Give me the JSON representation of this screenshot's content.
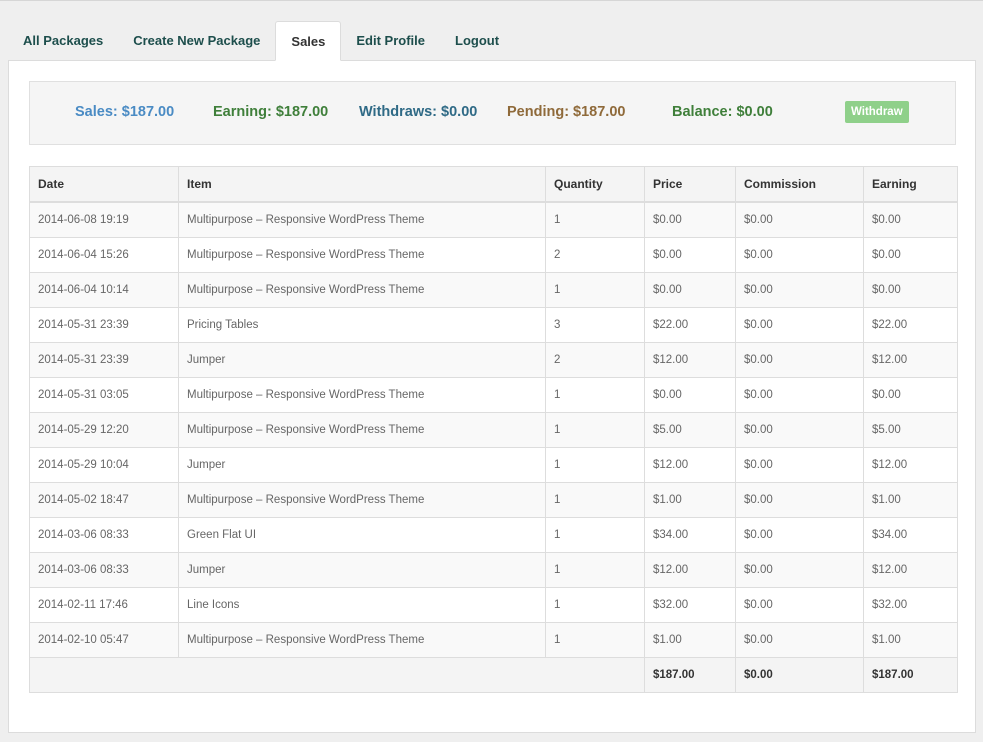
{
  "tabs": [
    {
      "label": "All Packages"
    },
    {
      "label": "Create New Package"
    },
    {
      "label": "Sales"
    },
    {
      "label": "Edit Profile"
    },
    {
      "label": "Logout"
    }
  ],
  "active_tab": "Sales",
  "summary": {
    "sales": "Sales: $187.00",
    "earning": "Earning: $187.00",
    "withdraws": "Withdraws: $0.00",
    "pending": "Pending: $187.00",
    "balance": "Balance: $0.00",
    "withdraw_button": "Withdraw"
  },
  "colors": {
    "sales": "#4a8bc4",
    "earning": "#3f7f3a",
    "withdraws": "#2f6a86",
    "pending": "#8f6a3a",
    "balance": "#3f7f3a",
    "withdraw_button": "#8fd08a"
  },
  "table": {
    "headers": [
      "Date",
      "Item",
      "Quantity",
      "Price",
      "Commission",
      "Earning"
    ],
    "rows": [
      [
        "2014-06-08 19:19",
        "Multipurpose – Responsive WordPress Theme",
        "1",
        "$0.00",
        "$0.00",
        "$0.00"
      ],
      [
        "2014-06-04 15:26",
        "Multipurpose – Responsive WordPress Theme",
        "2",
        "$0.00",
        "$0.00",
        "$0.00"
      ],
      [
        "2014-06-04 10:14",
        "Multipurpose – Responsive WordPress Theme",
        "1",
        "$0.00",
        "$0.00",
        "$0.00"
      ],
      [
        "2014-05-31 23:39",
        "Pricing Tables",
        "3",
        "$22.00",
        "$0.00",
        "$22.00"
      ],
      [
        "2014-05-31 23:39",
        "Jumper",
        "2",
        "$12.00",
        "$0.00",
        "$12.00"
      ],
      [
        "2014-05-31 03:05",
        "Multipurpose – Responsive WordPress Theme",
        "1",
        "$0.00",
        "$0.00",
        "$0.00"
      ],
      [
        "2014-05-29 12:20",
        "Multipurpose – Responsive WordPress Theme",
        "1",
        "$5.00",
        "$0.00",
        "$5.00"
      ],
      [
        "2014-05-29 10:04",
        "Jumper",
        "1",
        "$12.00",
        "$0.00",
        "$12.00"
      ],
      [
        "2014-05-02 18:47",
        "Multipurpose – Responsive WordPress Theme",
        "1",
        "$1.00",
        "$0.00",
        "$1.00"
      ],
      [
        "2014-03-06 08:33",
        "Green Flat UI",
        "1",
        "$34.00",
        "$0.00",
        "$34.00"
      ],
      [
        "2014-03-06 08:33",
        "Jumper",
        "1",
        "$12.00",
        "$0.00",
        "$12.00"
      ],
      [
        "2014-02-11 17:46",
        "Line Icons",
        "1",
        "$32.00",
        "$0.00",
        "$32.00"
      ],
      [
        "2014-02-10 05:47",
        "Multipurpose – Responsive WordPress Theme",
        "1",
        "$1.00",
        "$0.00",
        "$1.00"
      ]
    ],
    "totals": {
      "price": "$187.00",
      "commission": "$0.00",
      "earning": "$187.00"
    }
  }
}
